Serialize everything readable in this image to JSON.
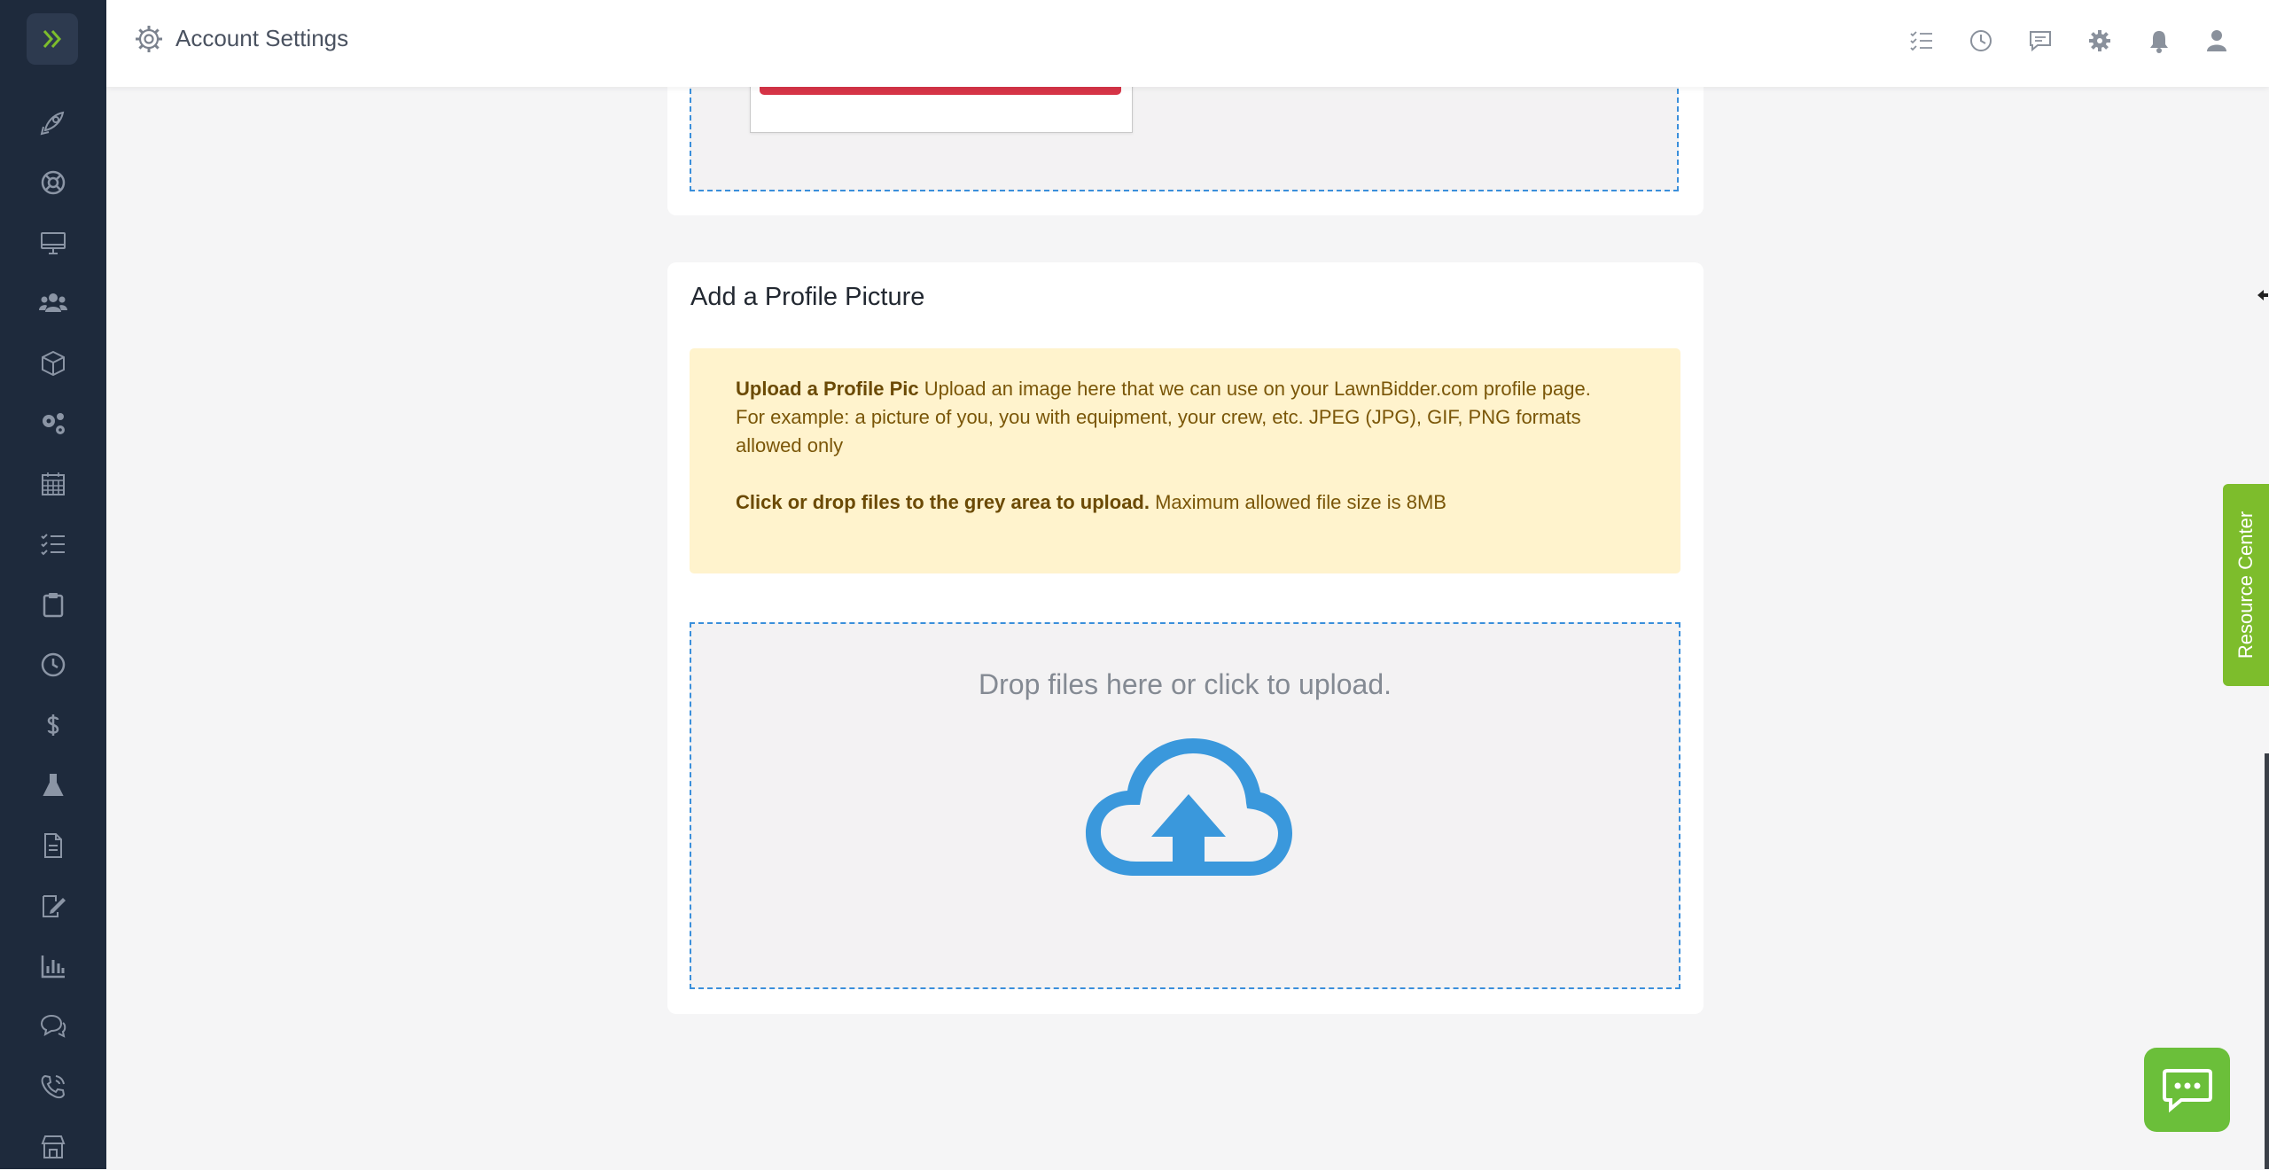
{
  "header": {
    "title": "Account Settings",
    "icons": [
      "checklist-icon",
      "clock-icon",
      "comment-icon",
      "gear-icon",
      "bell-icon",
      "user-icon"
    ]
  },
  "sidebar": {
    "items": [
      "rocket-icon",
      "lifebuoy-icon",
      "desktop-icon",
      "users-icon",
      "cube-icon",
      "cogs-icon",
      "calendar-icon",
      "tasks-icon",
      "clipboard-icon",
      "clock-icon",
      "dollar-icon",
      "flask-icon",
      "document-icon",
      "signature-icon",
      "chart-icon",
      "chat-icon",
      "phone-icon",
      "store-icon"
    ]
  },
  "profile_picture": {
    "title": "Add a Profile Picture",
    "alert_bold_1": "Upload a Profile Pic",
    "alert_text_1": " Upload an image here that we can use on your LawnBidder.com profile page.",
    "alert_text_2": "For example: a picture of you, you with equipment, your crew, etc. JPEG (JPG), GIF, PNG formats allowed only",
    "alert_bold_2": "Click or drop files to the grey area to upload.",
    "alert_text_3": " Maximum allowed file size is 8MB",
    "dropzone_message": "Drop files here or click to upload."
  },
  "resource_center": {
    "label": "Resource Center"
  },
  "colors": {
    "sidebar": "#1e2a3c",
    "accent_green": "#7dbd2c",
    "dropzone_border": "#3a8fdb",
    "alert_bg": "#fff3cd",
    "cloud": "#3a98dc",
    "remove_bar": "#d63447"
  }
}
